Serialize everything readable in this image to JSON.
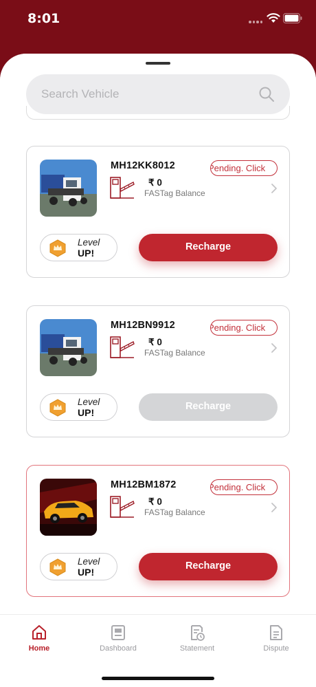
{
  "status": {
    "time": "8:01"
  },
  "search": {
    "placeholder": "Search Vehicle"
  },
  "vehicles": [
    {
      "plate": "MH12KK8012",
      "status": "Pending. Click",
      "balance": "₹ 0",
      "balance_label": "FASTag Balance",
      "level_line1": "Level",
      "level_line2": "UP!",
      "recharge_label": "Recharge",
      "recharge_enabled": true,
      "image": "blue-truck",
      "highlighted": false
    },
    {
      "plate": "MH12BN9912",
      "status": "Pending. Click",
      "balance": "₹ 0",
      "balance_label": "FASTag Balance",
      "level_line1": "Level",
      "level_line2": "UP!",
      "recharge_label": "Recharge",
      "recharge_enabled": false,
      "image": "blue-truck",
      "highlighted": false
    },
    {
      "plate": "MH12BM1872",
      "status": "Pending. Click",
      "balance": "₹ 0",
      "balance_label": "FASTag Balance",
      "level_line1": "Level",
      "level_line2": "UP!",
      "recharge_label": "Recharge",
      "recharge_enabled": true,
      "image": "yellow-car",
      "highlighted": true
    }
  ],
  "tabs": [
    {
      "label": "Home",
      "icon": "home-icon",
      "active": true
    },
    {
      "label": "Dashboard",
      "icon": "dashboard-icon",
      "active": false
    },
    {
      "label": "Statement",
      "icon": "statement-icon",
      "active": false
    },
    {
      "label": "Dispute",
      "icon": "dispute-icon",
      "active": false
    }
  ],
  "colors": {
    "brand": "#7a0d17",
    "accent": "#c0262f",
    "disabled": "#d4d5d7",
    "gold": "#f0a030"
  }
}
